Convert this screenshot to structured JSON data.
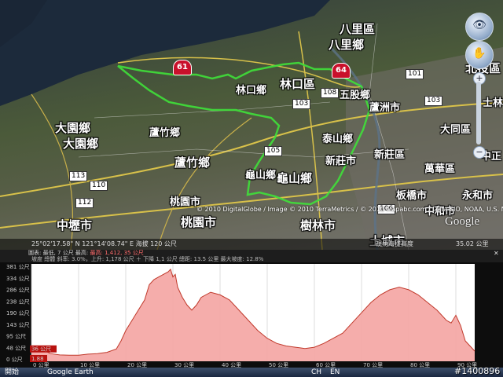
{
  "map": {
    "labels": {
      "balixiang_top": "八里區",
      "balixiang_2": "八里鄉",
      "beitou": "北投區",
      "linkouqu": "林口區",
      "linkouxiang": "林口鄉",
      "wugu": "五股鄉",
      "luzhou": "蘆洲市",
      "dayuan1": "大園鄉",
      "dayuan2": "大園鄉",
      "luzhu1": "蘆竹鄉",
      "luzhu2": "蘆竹鄉",
      "taishan": "泰山鄉",
      "xinzhuang": "新莊市",
      "xinzhuang2": "新莊區",
      "datong": "大同區",
      "wanhua": "萬華區",
      "guishan1": "龜山鄉",
      "guishan2": "龜山鄉",
      "banqiao": "板橋市",
      "yonghe": "永和市",
      "zhonghe": "中和市",
      "taoyuan1": "桃園市",
      "taoyuan2": "桃園市",
      "shulin": "樹林市",
      "tucheng": "土城市",
      "zhongli": "中壢市",
      "shilin": "士林",
      "zhong": "中正"
    },
    "route_badges": {
      "r61": "61",
      "r64": "64"
    },
    "highway_boxes": [
      "103",
      "108",
      "105",
      "106",
      "113",
      "110",
      "101",
      "112",
      "103"
    ],
    "attribution": "© 2010 DigitalGlobe / Image © 2010 TerraMetrics / © 2010 Mapabc.com / Data SIO, NOAA, U.S. Navy",
    "google_logo": "Google",
    "status_left": "25°02'17.58\" N  121°14'08.74\" E  海拔 120 公尺",
    "status_right": "視角海拔高度",
    "status_alt": "35.02 公里",
    "nav": {
      "look": "👁",
      "move": "✋",
      "zoom_in": "+",
      "zoom_out": "−"
    }
  },
  "profile": {
    "header_line1_prefix": "圖表: 最低, 7 公尺 最高:",
    "header_line1_highlight": "最高: 1,412, 35 公尺",
    "header_line2": "坡度 總體 斜率: 3.0%，上升: 1,178 公尺 ＋ 下降 1,1 公尺 總距: 13.5 公里 最大坡度: 12.8%",
    "close": "✕",
    "y_ticks": [
      "381 公尺",
      "334 公尺",
      "286 公尺",
      "238 公尺",
      "190 公尺",
      "143 公尺",
      "95 公尺",
      "48 公尺",
      "0 公尺"
    ],
    "x_ticks": [
      "0 公里",
      "10 公里",
      "20 公里",
      "30 公里",
      "40 公里",
      "50 公里",
      "60 公里",
      "70 公里",
      "80 公里",
      "90 公里"
    ],
    "start_marker": "36 公尺",
    "end_marker": "1.88"
  },
  "chart_data": {
    "type": "area",
    "title": "",
    "xlabel": "",
    "ylabel": "",
    "ylim": [
      0,
      381
    ],
    "x_range_km": [
      0,
      94
    ],
    "x": [
      0,
      1,
      2,
      3,
      4,
      6,
      8,
      10,
      12,
      14,
      16,
      18,
      19,
      20,
      22,
      24,
      25,
      26,
      27,
      28,
      29,
      29.5,
      30,
      30.5,
      31,
      32,
      33,
      34,
      35,
      36,
      38,
      40,
      42,
      44,
      46,
      48,
      50,
      52,
      54,
      56,
      58,
      60,
      62,
      64,
      66,
      68,
      70,
      72,
      74,
      76,
      78,
      80,
      82,
      84,
      86,
      88,
      89,
      90,
      91,
      92,
      93,
      94
    ],
    "series": [
      {
        "values": [
          50,
          60,
          55,
          40,
          30,
          25,
          24,
          24,
          28,
          30,
          35,
          48,
          80,
          120,
          180,
          240,
          300,
          320,
          330,
          340,
          350,
          360,
          330,
          340,
          290,
          250,
          220,
          200,
          220,
          250,
          270,
          260,
          240,
          200,
          160,
          120,
          90,
          70,
          60,
          55,
          50,
          55,
          70,
          90,
          110,
          150,
          190,
          230,
          260,
          280,
          290,
          280,
          260,
          230,
          200,
          160,
          150,
          180,
          140,
          80,
          60,
          40
        ]
      }
    ]
  },
  "taskbar": {
    "items": [
      "開始",
      "Google Earth",
      "CH",
      "EN"
    ]
  },
  "watermark": "#1400896"
}
